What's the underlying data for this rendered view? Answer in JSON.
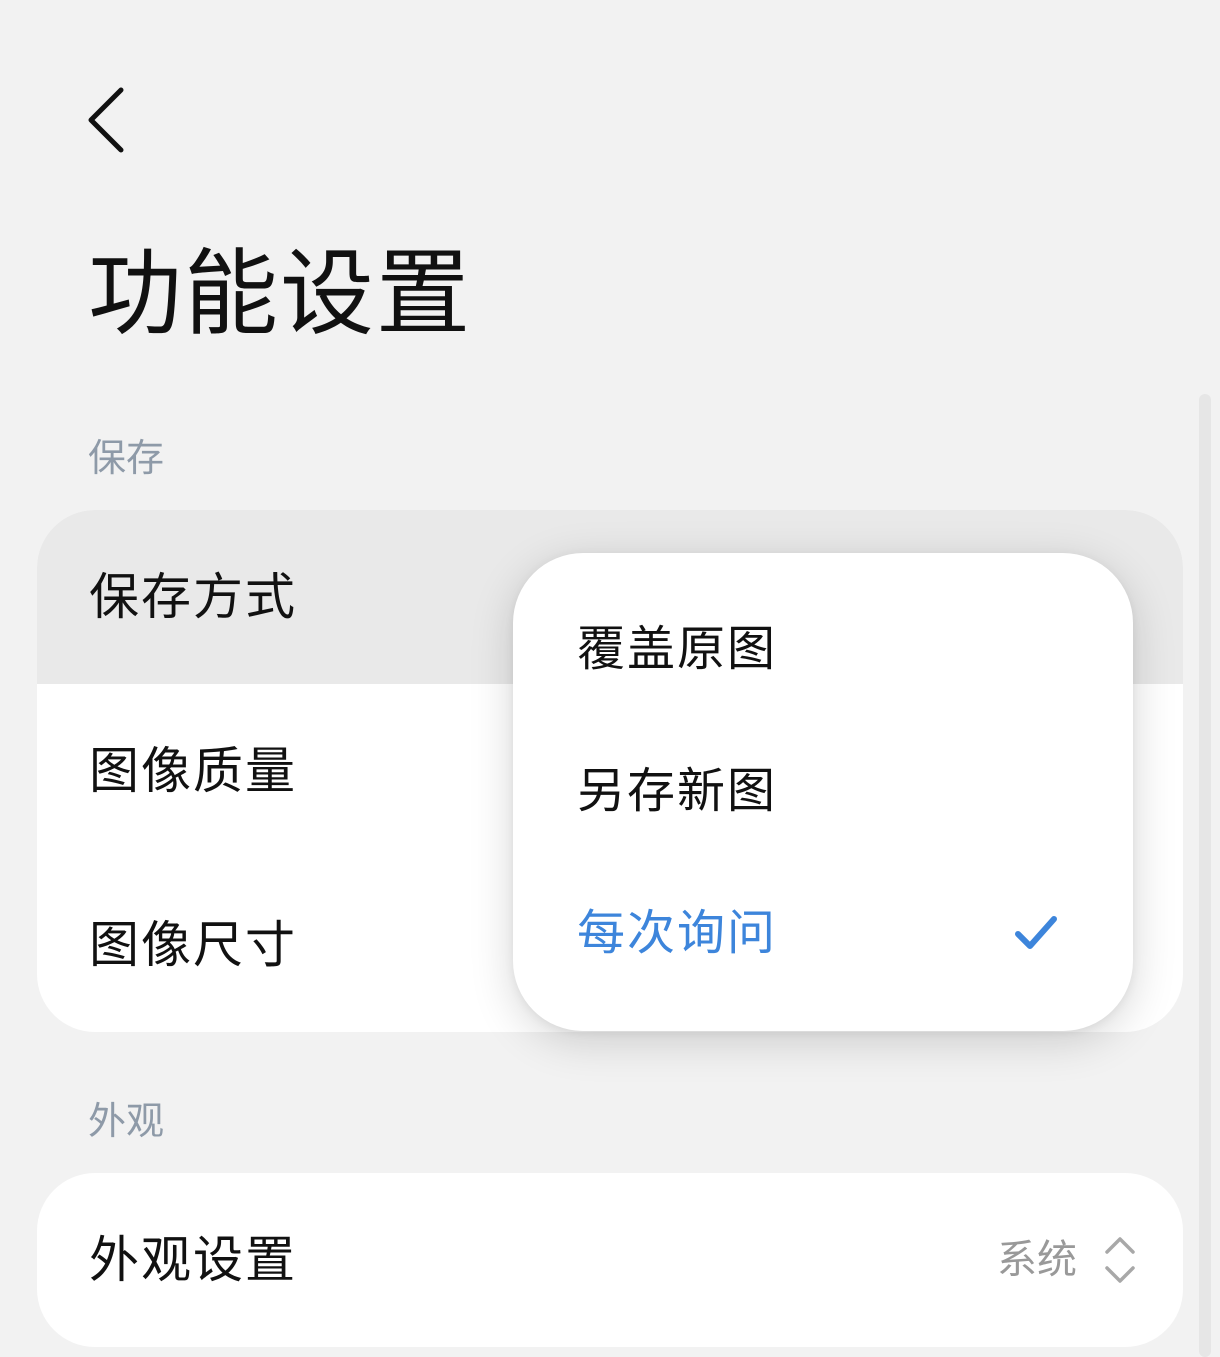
{
  "header": {
    "back_icon": "chevron-left-icon",
    "title": "功能设置"
  },
  "sections": [
    {
      "header": "保存",
      "rows": [
        {
          "label": "保存方式"
        },
        {
          "label": "图像质量"
        },
        {
          "label": "图像尺寸"
        }
      ]
    },
    {
      "header": "外观",
      "rows": [
        {
          "label": "外观设置",
          "value": "系统",
          "icon": "up-down-chevron-icon"
        }
      ]
    }
  ],
  "popup_menu": {
    "items": [
      {
        "label": "覆盖原图",
        "selected": false
      },
      {
        "label": "另存新图",
        "selected": false
      },
      {
        "label": "每次询问",
        "selected": true,
        "icon": "checkmark-icon"
      }
    ]
  },
  "colors": {
    "background": "#f2f2f2",
    "card": "#ffffff",
    "pressed_row": "#e9e9e9",
    "section_header": "#8e9aa8",
    "accent": "#3d85db",
    "secondary_text": "#999999"
  }
}
